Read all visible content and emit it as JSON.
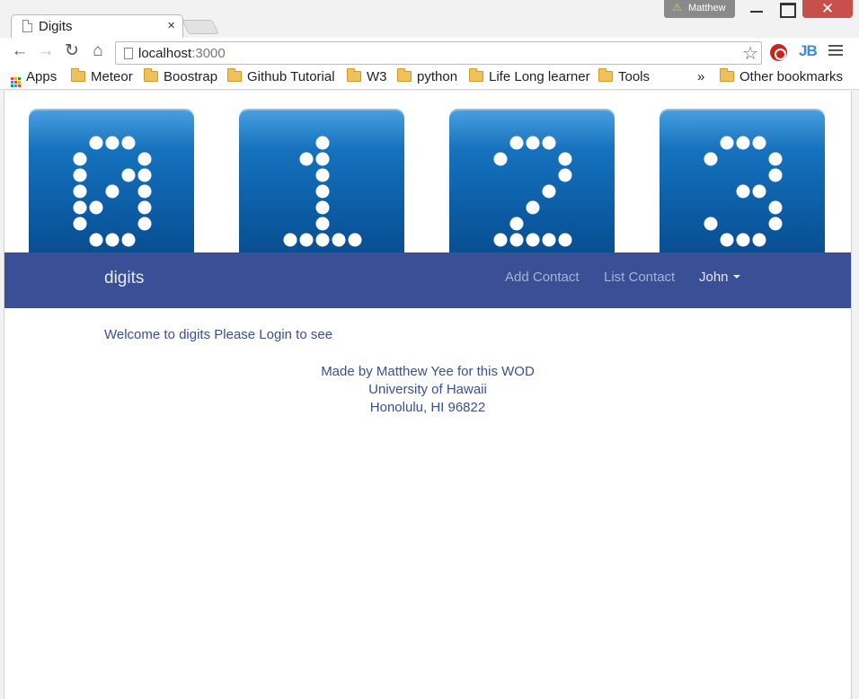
{
  "browser": {
    "tab_title": "Digits",
    "tab_close": "×",
    "profile_name": "Matthew",
    "url_host": "localhost",
    "url_port": ":3000",
    "bookmarks": [
      {
        "label": "Apps",
        "icon": "apps-icon"
      },
      {
        "label": "Meteor",
        "icon": "folder-icon"
      },
      {
        "label": "Boostrap",
        "icon": "folder-icon"
      },
      {
        "label": "Github Tutorial",
        "icon": "folder-icon"
      },
      {
        "label": "W3",
        "icon": "folder-icon"
      },
      {
        "label": "python",
        "icon": "folder-icon"
      },
      {
        "label": "Life Long learner",
        "icon": "folder-icon"
      },
      {
        "label": "Tools",
        "icon": "folder-icon"
      }
    ],
    "bookmarks_more": "»",
    "other_bookmarks": "Other bookmarks",
    "extension_jb": "JB"
  },
  "banner": {
    "digits": [
      "0",
      "1",
      "2",
      "3"
    ],
    "tile_color": "#0b5ca4"
  },
  "navbar": {
    "brand": "digits",
    "add_contact": "Add Contact",
    "list_contact": "List Contact",
    "user": "John",
    "background": "#3a4f95"
  },
  "main": {
    "welcome": "Welcome to digits Please Login to see"
  },
  "footer": {
    "line1": "Made by Matthew Yee for this WOD",
    "line2": "University of Hawaii",
    "line3": "Honolulu, HI 96822"
  }
}
